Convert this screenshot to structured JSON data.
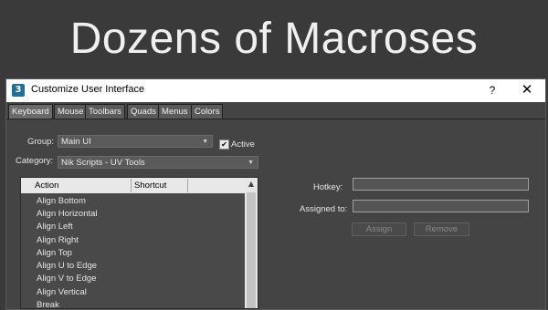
{
  "banner": {
    "title": "Dozens of Macroses"
  },
  "window": {
    "app_icon": "3",
    "title": "Customize User Interface",
    "help_label": "?",
    "close_label": "✕"
  },
  "tabs": [
    "Keyboard",
    "Mouse",
    "Toolbars",
    "Quads",
    "Menus",
    "Colors"
  ],
  "active_tab": "Keyboard",
  "group": {
    "label": "Group:",
    "value": "Main UI"
  },
  "active_checkbox": {
    "label": "Active",
    "checked": true,
    "mark": "✔"
  },
  "category": {
    "label": "Category:",
    "value": "Nik Scripts - UV Tools"
  },
  "action_list": {
    "columns": [
      "Action",
      "Shortcut"
    ],
    "rows": [
      "Align Bottom",
      "Align Horizontal",
      "Align Left",
      "Align Right",
      "Align Top",
      "Align U to Edge",
      "Align V to Edge",
      "Align Vertical",
      "Break"
    ],
    "scroll_up": "▲"
  },
  "hotkey": {
    "label": "Hotkey:",
    "value": ""
  },
  "assigned_to": {
    "label": "Assigned to:",
    "value": ""
  },
  "buttons": {
    "assign": "Assign",
    "remove": "Remove"
  },
  "combo_arrow": "▼"
}
